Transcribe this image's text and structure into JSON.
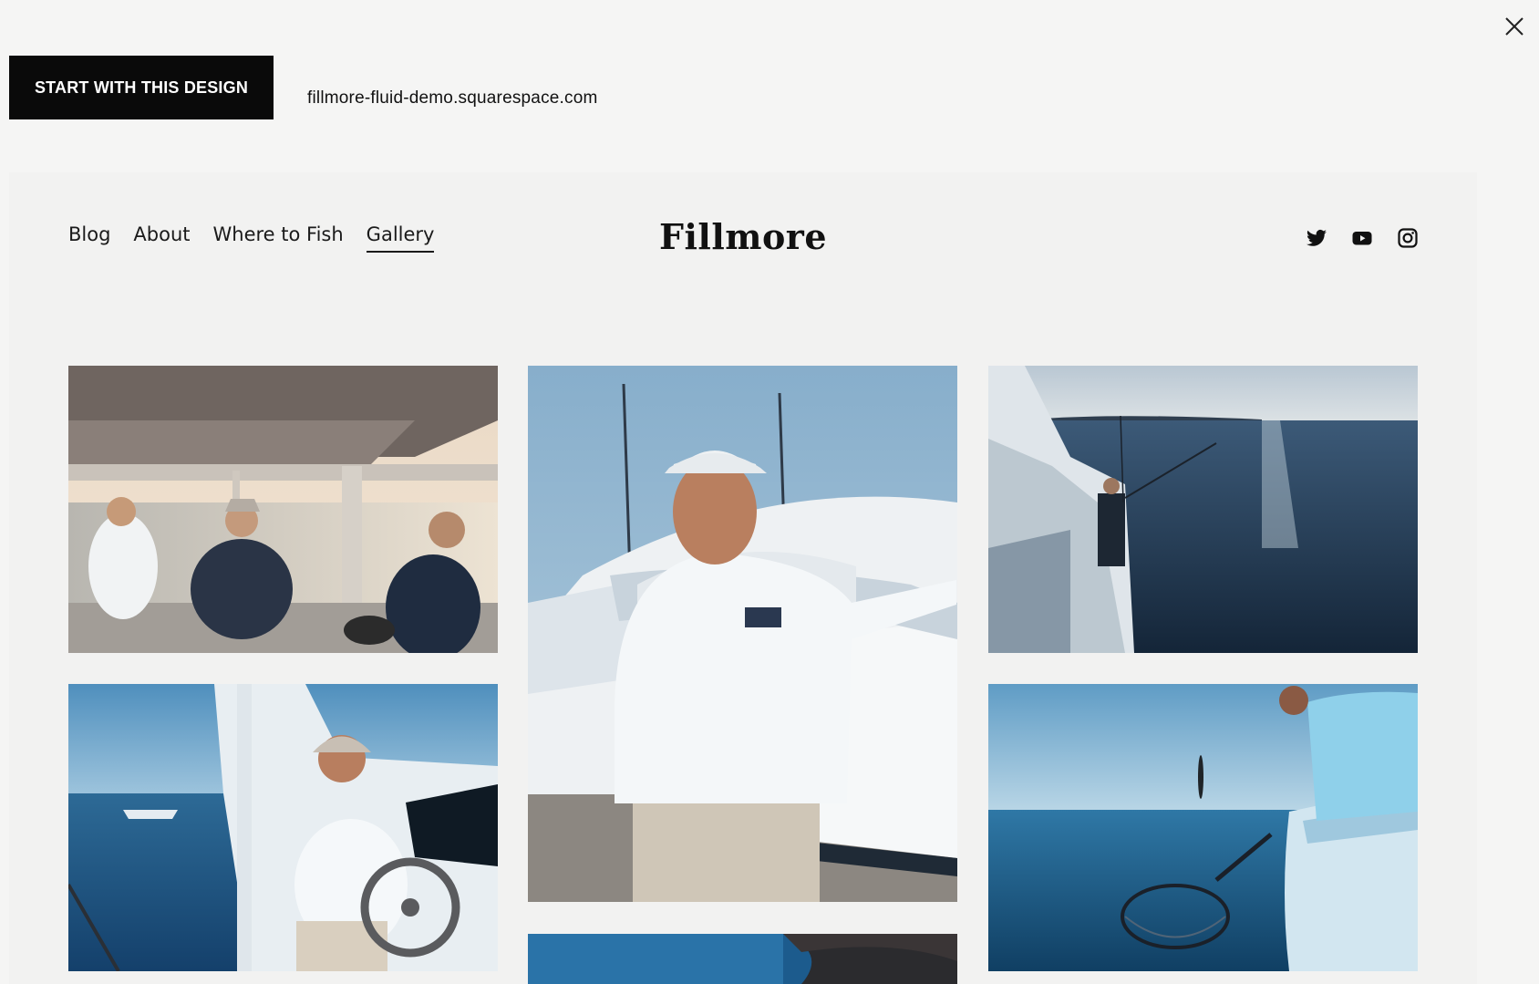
{
  "toolbar": {
    "start_label": "START WITH THIS DESIGN",
    "site_url": "fillmore-fluid-demo.squarespace.com",
    "close_icon": "close-icon"
  },
  "site": {
    "logo": "Fillmore",
    "nav": [
      {
        "label": "Blog",
        "active": false
      },
      {
        "label": "About",
        "active": false
      },
      {
        "label": "Where to Fish",
        "active": false
      },
      {
        "label": "Gallery",
        "active": true
      }
    ],
    "social_icons": [
      "twitter-icon",
      "youtube-icon",
      "instagram-icon"
    ]
  },
  "gallery": {
    "images": [
      "photo-men-on-boat-under-canopy",
      "photo-captain-portrait-at-dock",
      "photo-angler-casting-from-bow",
      "photo-captain-at-helm",
      "photo-netting-fish-overboard",
      "photo-cropped-ocean-partial"
    ]
  }
}
